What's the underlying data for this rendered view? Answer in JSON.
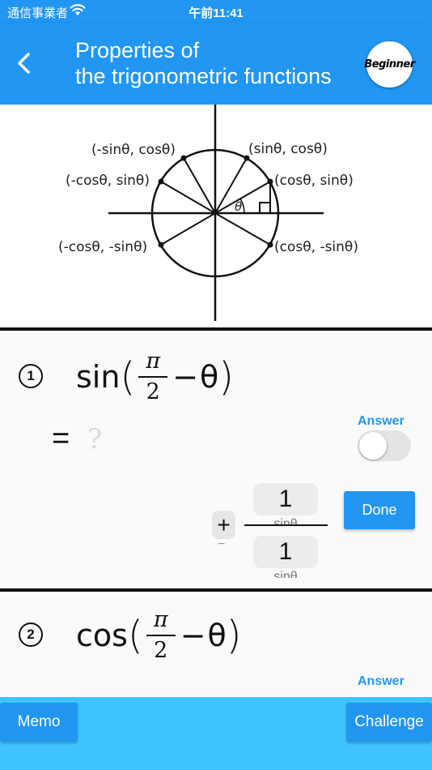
{
  "status_bar": {
    "carrier": "通信事業者",
    "time": "午前11:41"
  },
  "app_bar": {
    "title_line1": "Properties of",
    "title_line2": "the trigonometric functions",
    "level_badge": "Beginner"
  },
  "diagram": {
    "labels": {
      "neg_sin_cos": "(-sinθ, cosθ)",
      "sin_cos": "(sinθ, cosθ)",
      "neg_cos_sin": "(-cosθ, sinθ)",
      "cos_sin": "(cosθ, sinθ)",
      "neg_cos_neg_sin": "(-cosθ, -sinθ)",
      "cos_neg_sin": "(cosθ, -sinθ)",
      "theta": "θ"
    }
  },
  "problems": [
    {
      "number": "1",
      "func": "sin",
      "numerator": "π",
      "denominator": "2",
      "minus": "−",
      "variable": "θ",
      "equals": "=",
      "placeholder": "?",
      "answer_label": "Answer",
      "answer_toggle_on": false
    },
    {
      "number": "2",
      "func": "cos",
      "numerator": "π",
      "denominator": "2",
      "minus": "−",
      "variable": "θ",
      "answer_label": "Answer"
    }
  ],
  "answer_input": {
    "sign_plus": "+",
    "sign_minus": "−",
    "numerator_value": "1",
    "numerator_sub": "sinθ",
    "denominator_value": "1",
    "denominator_sub": "sinθ",
    "done_label": "Done"
  },
  "bottom": {
    "memo_label": "Memo",
    "challenge_label": "Challenge"
  }
}
